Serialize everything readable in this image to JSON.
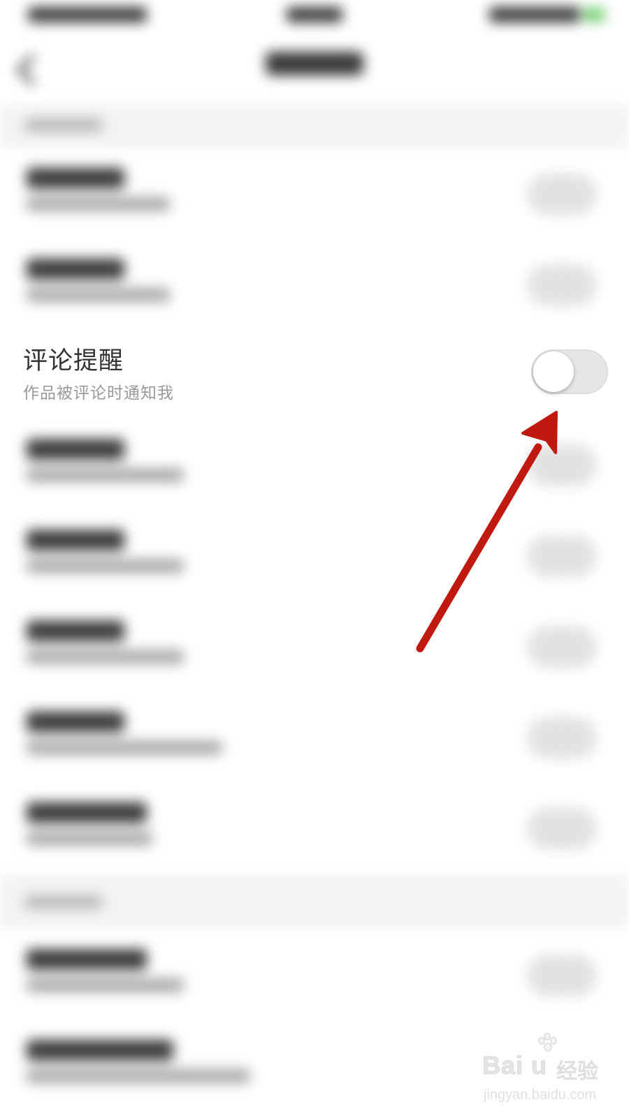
{
  "settings": {
    "comment_reminder": {
      "title": "评论提醒",
      "subtitle": "作品被评论时通知我",
      "toggle_on": false
    }
  },
  "colors": {
    "annotation_arrow": "#c0190f",
    "toggle_track_off": "#e6e6e6",
    "title_text": "#333333",
    "subtitle_text": "#999999"
  },
  "watermark": {
    "brand": "Bai  u",
    "brand_cn": "经验",
    "url": "jingyan.baidu.com"
  },
  "icons": {
    "arrow": "red-arrow-icon",
    "paw": "baidu-paw-icon"
  }
}
